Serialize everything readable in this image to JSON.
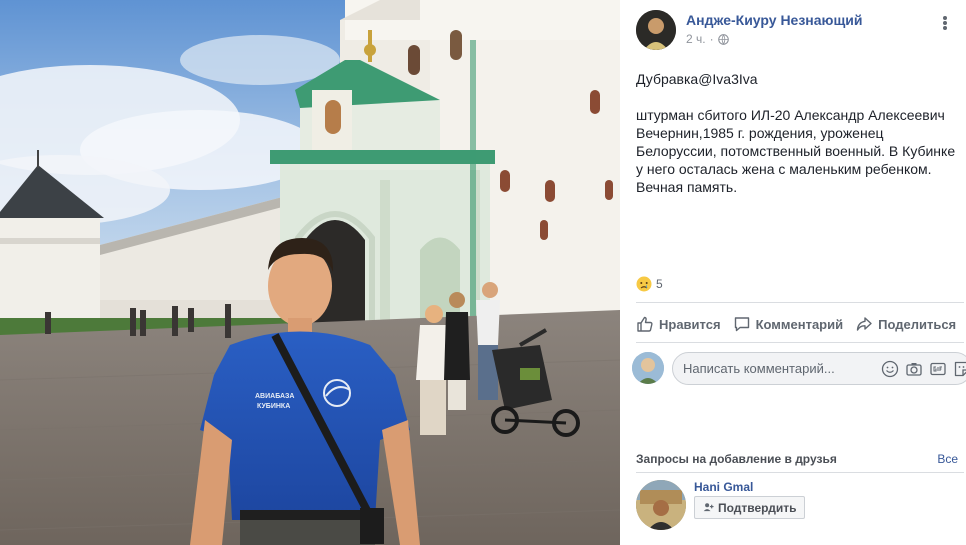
{
  "post": {
    "author_name": "Андже-Киуру Незнающий",
    "time": "2 ч.",
    "privacy_icon": "globe-icon",
    "paragraphs": [
      "Дубравка@Iva3Iva",
      "штурман сбитого ИЛ-20 Александр Алексеевич Вечернин,1985 г. рождения, уроженец Белоруссии, потомственный военный. В Кубинке у него осталась жена с маленьким ребенком. Вечная память."
    ],
    "reaction_icon": "sad-reaction-icon",
    "reaction_count": "5"
  },
  "actions": {
    "like": "Нравится",
    "comment": "Комментарий",
    "share": "Поделиться"
  },
  "comment": {
    "placeholder": "Написать комментарий..."
  },
  "friend_requests": {
    "title": "Запросы на добавление в друзья",
    "see_all": "Все",
    "items": [
      {
        "name": "Hani Gmal",
        "confirm_label": "Подтвердить"
      }
    ]
  },
  "photo": {
    "shirt_text_line1": "АВИАБАЗА",
    "shirt_text_line2": "КУБИНКА"
  },
  "colors": {
    "link": "#385898",
    "secondary_text": "#606770",
    "divider": "#dadde1"
  }
}
